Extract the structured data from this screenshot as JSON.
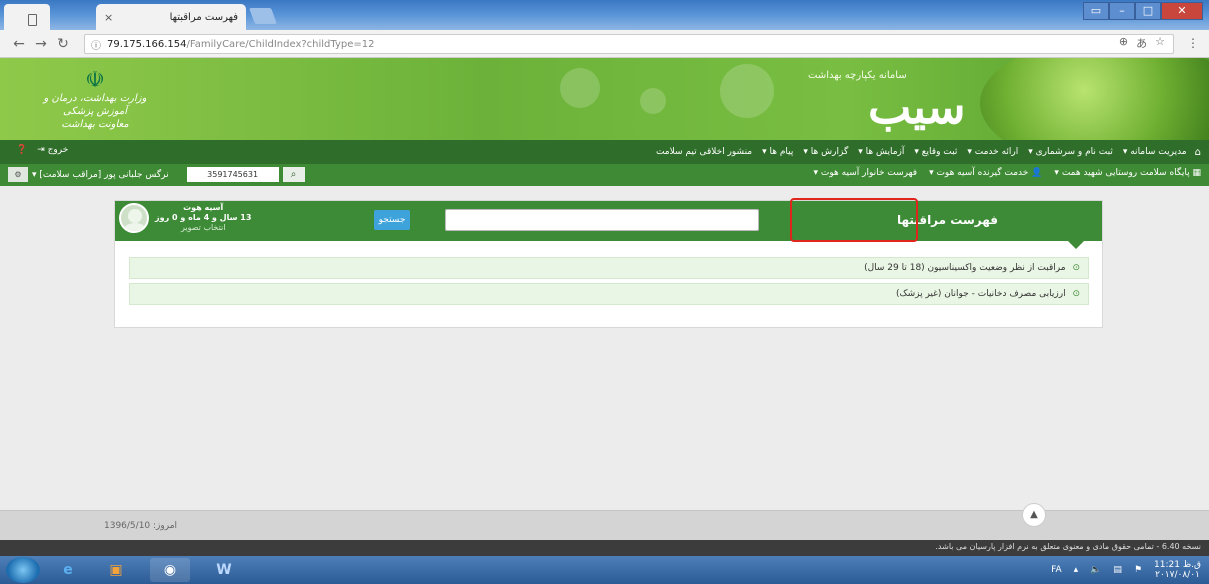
{
  "browser": {
    "tab_title": "فهرست مراقبتها",
    "tab_close": "×",
    "url_info_icon": "ⓘ",
    "url_host": "79.175.166.154",
    "url_path": "/FamilyCare/ChildIndex?childType=12"
  },
  "header": {
    "ministry_line1": "وزارت بهداشت، درمان و آموزش پزشکی",
    "ministry_line2": "معاونت بهداشت",
    "brand_text": "سامانه یکپارچه بهداشت",
    "brand_logo": "سیب"
  },
  "mainnav": {
    "items": [
      "مدیریت سامانه",
      "ثبت نام و سرشماری",
      "ارائه خدمت",
      "ثبت وقایع",
      "آزمایش ها",
      "گزارش ها",
      "پیام ها",
      "منشور اخلاقی تیم سلامت"
    ],
    "logout": "خروج"
  },
  "subnav": {
    "items": [
      "پایگاه سلامت روستایی شهید همت",
      "خدمت گیرنده آسیه هوت",
      "فهرست خانوار آسیه هوت"
    ],
    "user_name": "نرگس جلبانی پور [مراقب سلامت]",
    "code_value": "3591745631"
  },
  "panel": {
    "title": "فهرست مراقبتها",
    "search_button": "جستجو",
    "profile_name": "آسیه هوت",
    "profile_age": "13 سال و 4 ماه و 0 روز",
    "profile_change": "انتخاب تصویر",
    "items": [
      "مراقبت از نظر وضعیت واکسیناسیون (18 تا 29 سال)",
      "ارزیابی مصرف دخانیات - جوانان (غیر پزشک)"
    ]
  },
  "footer": {
    "today": "امروز: 1396/5/10",
    "version": "نسخه 6.40 - تمامی حقوق مادی و معنوی متعلق به نرم افزار پارسیان می باشد."
  },
  "taskbar": {
    "lang": "FA",
    "time": "11:21 ق.ظ",
    "date": "۲۰۱۷/۰۸/۰۱"
  }
}
